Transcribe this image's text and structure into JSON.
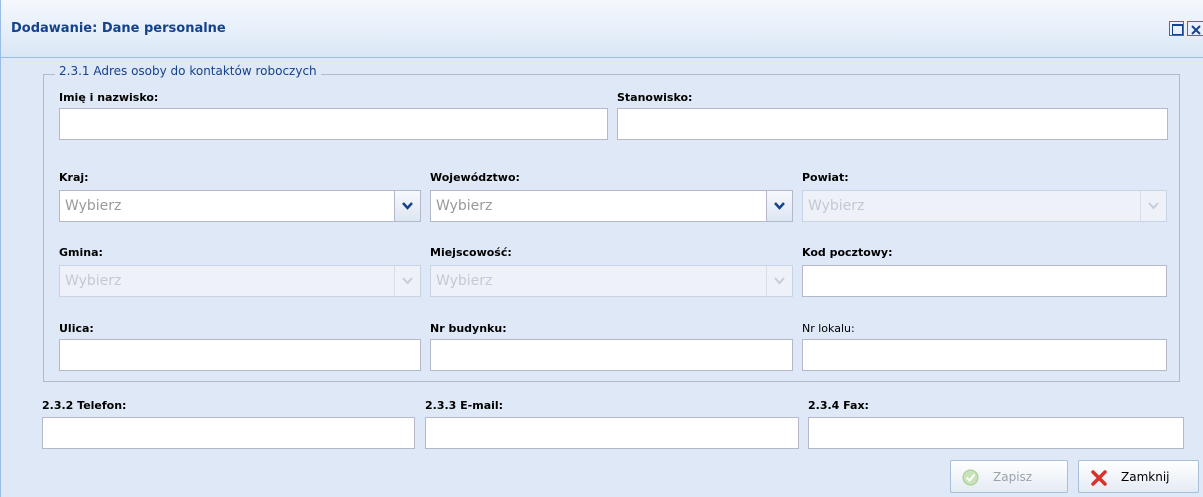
{
  "window": {
    "title": "Dodawanie: Dane personalne"
  },
  "section": {
    "legend": "2.3.1 Adres osoby do kontaktów roboczych"
  },
  "fields": {
    "imie_nazwisko": {
      "label": "Imię i nazwisko:",
      "value": ""
    },
    "stanowisko": {
      "label": "Stanowisko:",
      "value": ""
    },
    "kraj": {
      "label": "Kraj:",
      "placeholder": "Wybierz"
    },
    "wojewodztwo": {
      "label": "Województwo:",
      "placeholder": "Wybierz"
    },
    "powiat": {
      "label": "Powiat:",
      "placeholder": "Wybierz"
    },
    "gmina": {
      "label": "Gmina:",
      "placeholder": "Wybierz"
    },
    "miejscowosc": {
      "label": "Miejscowość:",
      "placeholder": "Wybierz"
    },
    "kod_pocztowy": {
      "label": "Kod pocztowy:",
      "value": ""
    },
    "ulica": {
      "label": "Ulica:",
      "value": ""
    },
    "nr_budynku": {
      "label": "Nr budynku:",
      "value": ""
    },
    "nr_lokalu": {
      "label": "Nr lokalu:",
      "value": ""
    },
    "telefon": {
      "label": "2.3.2 Telefon:",
      "value": ""
    },
    "email": {
      "label": "2.3.3 E-mail:",
      "value": ""
    },
    "fax": {
      "label": "2.3.4 Fax:",
      "value": ""
    }
  },
  "buttons": {
    "save": "Zapisz",
    "close": "Zamknij"
  },
  "colors": {
    "title": "#15428b",
    "panel_bg": "#dfe8f6",
    "border": "#b5b8c8"
  },
  "icons": {
    "save": "check-circle-icon",
    "close": "red-x-icon"
  }
}
